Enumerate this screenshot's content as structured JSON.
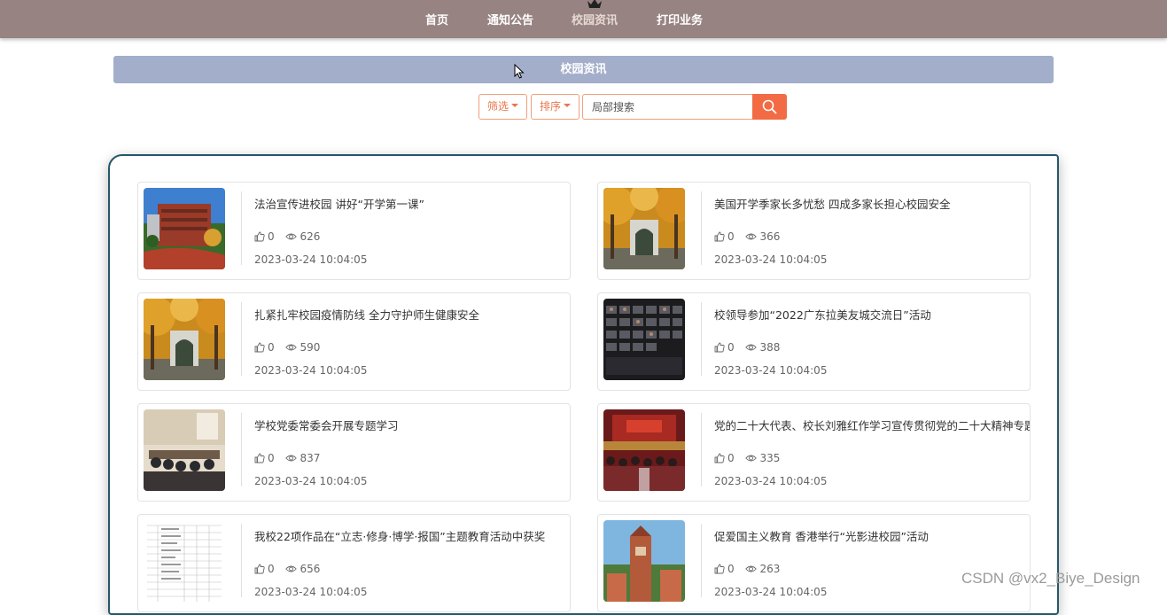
{
  "nav": {
    "items": [
      {
        "label": "首页"
      },
      {
        "label": "通知公告"
      },
      {
        "label": "校园资讯"
      },
      {
        "label": "打印业务"
      }
    ],
    "active_index": 2,
    "bg_color": "#978381"
  },
  "section": {
    "title": "校园资讯",
    "bg_color": "#a3aecb"
  },
  "search": {
    "filter_label": "筛选",
    "sort_label": "排序",
    "placeholder": "局部搜索",
    "button_icon": "search-icon",
    "accent_color": "#f26b45"
  },
  "news": [
    {
      "title": "法治宣传进校园 讲好“开学第一课”",
      "likes": "0",
      "views": "626",
      "date": "2023-03-24 10:04:05"
    },
    {
      "title": "美国开学季家长多忧愁 四成多家长担心校园安全",
      "likes": "0",
      "views": "366",
      "date": "2023-03-24 10:04:05"
    },
    {
      "title": "扎紧扎牢校园疫情防线 全力守护师生健康安全",
      "likes": "0",
      "views": "590",
      "date": "2023-03-24 10:04:05"
    },
    {
      "title": "校领导参加“2022广东拉美友城交流日”活动",
      "likes": "0",
      "views": "388",
      "date": "2023-03-24 10:04:05"
    },
    {
      "title": "学校党委常委会开展专题学习",
      "likes": "0",
      "views": "837",
      "date": "2023-03-24 10:04:05"
    },
    {
      "title": "党的二十大代表、校长刘雅红作学习宣传贯彻党的二十大精神专题",
      "likes": "0",
      "views": "335",
      "date": "2023-03-24 10:04:05"
    },
    {
      "title": "我校22项作品在“立志·修身·博学·报国”主题教育活动中获奖",
      "likes": "0",
      "views": "656",
      "date": "2023-03-24 10:04:05"
    },
    {
      "title": "促爱国主义教育 香港举行“光影进校园”活动",
      "likes": "0",
      "views": "263",
      "date": "2023-03-24 10:04:05"
    }
  ],
  "watermark": "CSDN @vx2_Biye_Design"
}
